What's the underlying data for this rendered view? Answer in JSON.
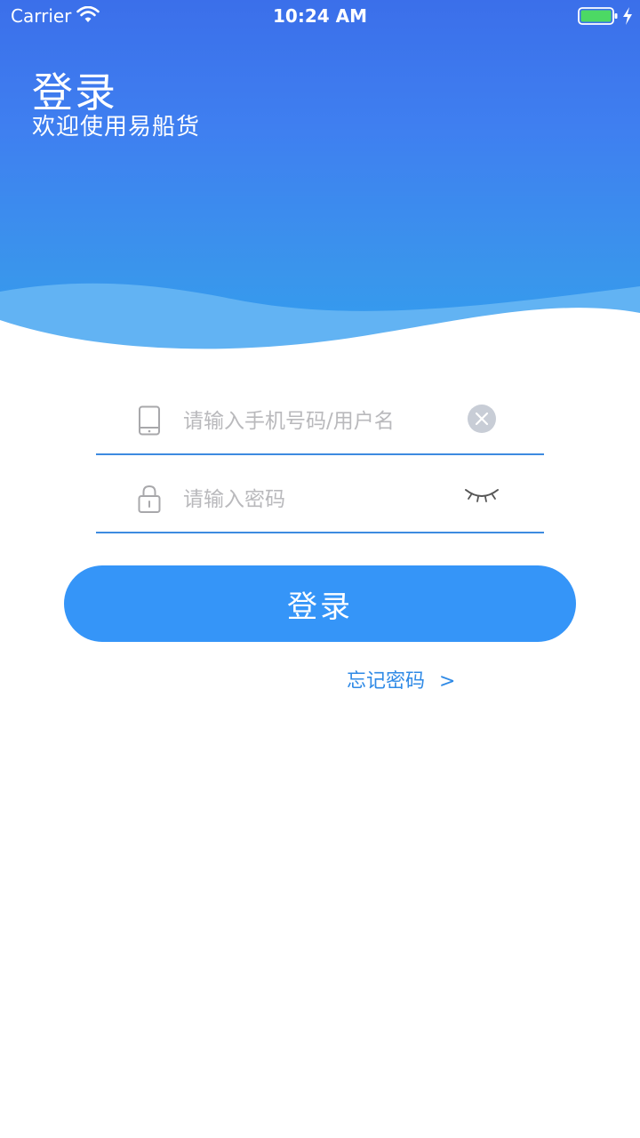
{
  "status_bar": {
    "carrier": "Carrier",
    "time": "10:24 AM",
    "battery_color": "#4cd964"
  },
  "header": {
    "title": "登录",
    "subtitle": "欢迎使用易船货",
    "gradient_top": "#3b6fea",
    "gradient_bottom": "#2f9ff0"
  },
  "form": {
    "username": {
      "value": "",
      "placeholder": "请输入手机号码/用户名",
      "icon": "phone-icon",
      "action_icon": "clear-icon"
    },
    "password": {
      "value": "",
      "placeholder": "请输入密码",
      "icon": "lock-icon",
      "action_icon": "eye-closed-icon"
    },
    "underline_color": "#3d8be0"
  },
  "actions": {
    "login_label": "登录",
    "login_color": "#3595f8",
    "forgot_label": "忘记密码",
    "forgot_chevron": ">"
  }
}
